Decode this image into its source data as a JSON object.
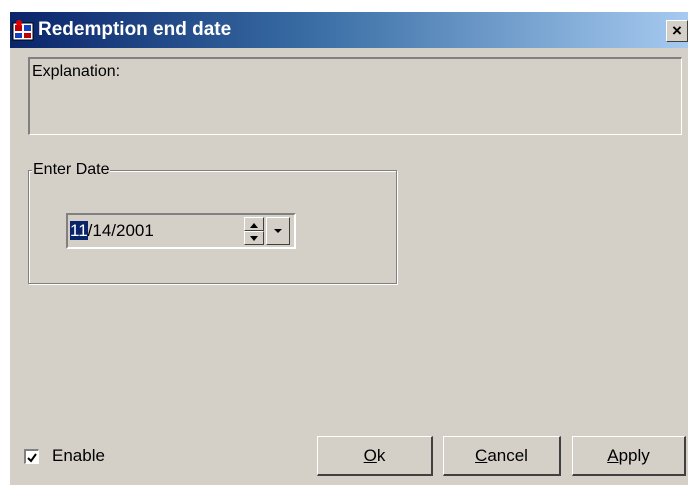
{
  "window": {
    "title": "Redemption end date",
    "close_symbol": "×"
  },
  "explanation": {
    "label": "Explanation:"
  },
  "date_group": {
    "legend": "Enter Date",
    "month": "11",
    "rest": "/14/2001"
  },
  "footer": {
    "enable_label": "Enable",
    "enable_checked": true
  },
  "buttons": {
    "ok": {
      "accel": "O",
      "rest": "k"
    },
    "cancel": {
      "accel": "C",
      "rest": "ancel"
    },
    "apply": {
      "accel": "A",
      "rest": "pply"
    }
  },
  "icons": {
    "app": "app-icon",
    "close": "close-icon",
    "spin_up": "arrow-up-icon",
    "spin_down": "arrow-down-icon",
    "dropdown": "chevron-down-icon",
    "check": "checkmark-icon"
  },
  "colors": {
    "face": "#d4d0c8",
    "title_start": "#0a246a",
    "title_end": "#a6caf0",
    "selection": "#0a246a"
  }
}
